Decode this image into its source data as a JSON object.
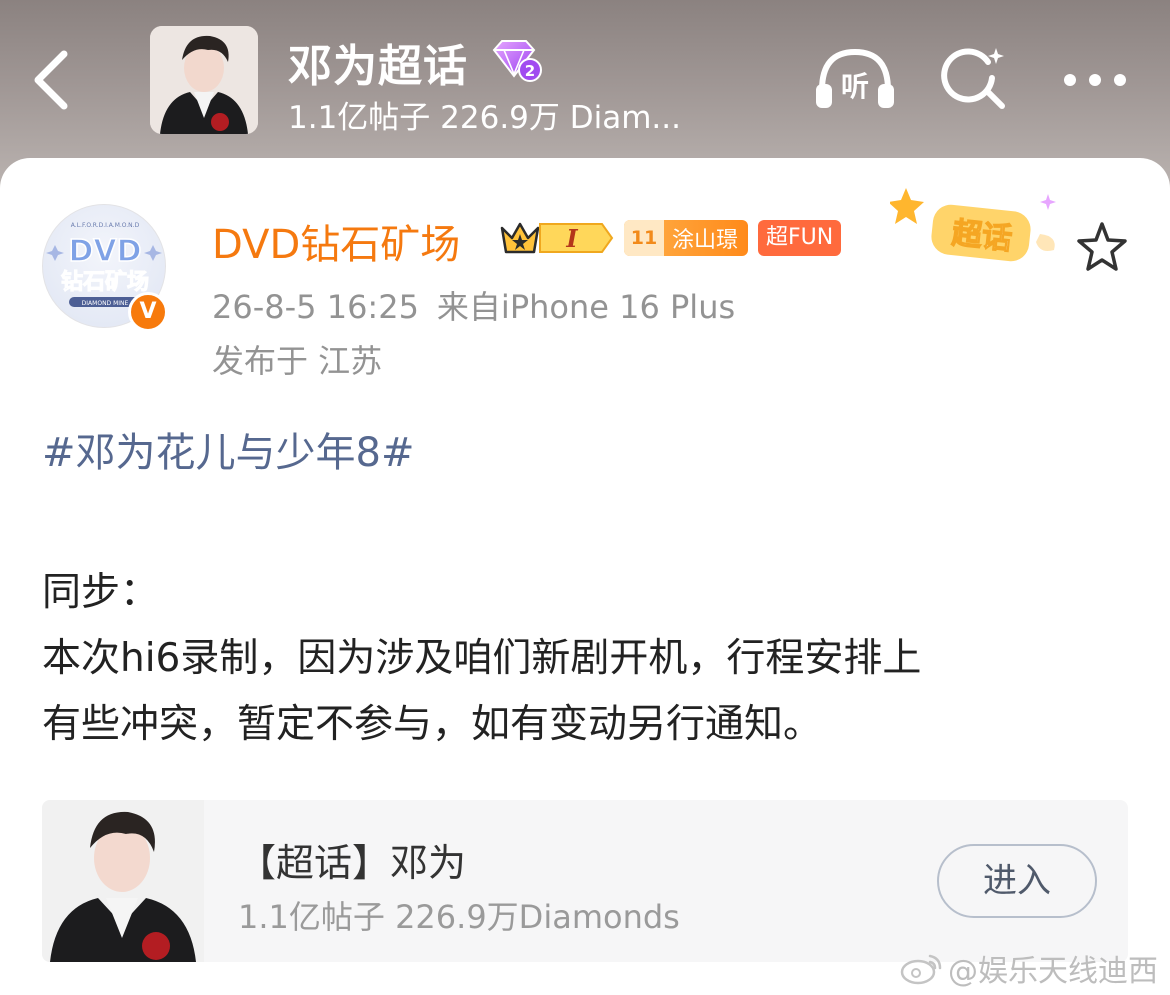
{
  "header": {
    "title": "邓为超话",
    "level_badge_number": "2",
    "stats": "1.1亿帖子 226.9万 Diam...",
    "listen_label": "听"
  },
  "post": {
    "author": {
      "name": "DVD钻石矿场",
      "avatar_text_line1": "DVD",
      "avatar_text_line2": "钻石矿场",
      "avatar_text_line3": "DIAMOND MINE",
      "verified_mark": "V"
    },
    "badges": {
      "crown_level": "I",
      "fans_level": "11",
      "fans_name": "涂山璟",
      "fun_label": "超FUN"
    },
    "chaohua_sticker": "超话",
    "time": "26-8-5 16:25",
    "source": "来自iPhone 16 Plus",
    "location": "发布于 江苏",
    "hashtag": "#邓为花儿与少年8#",
    "body_lines": [
      "同步：",
      "本次hi6录制，因为涉及咱们新剧开机，行程安排上",
      "有些冲突，暂定不参与，如有变动另行通知。"
    ]
  },
  "topic_card": {
    "title": "【超话】邓为",
    "stats": "1.1亿帖子 226.9万Diamonds",
    "enter_label": "进入"
  },
  "watermark": "@娱乐天线迪西",
  "colors": {
    "accent_orange": "#f5790f",
    "hashtag_blue": "#56688f",
    "meta_gray": "#939393"
  }
}
